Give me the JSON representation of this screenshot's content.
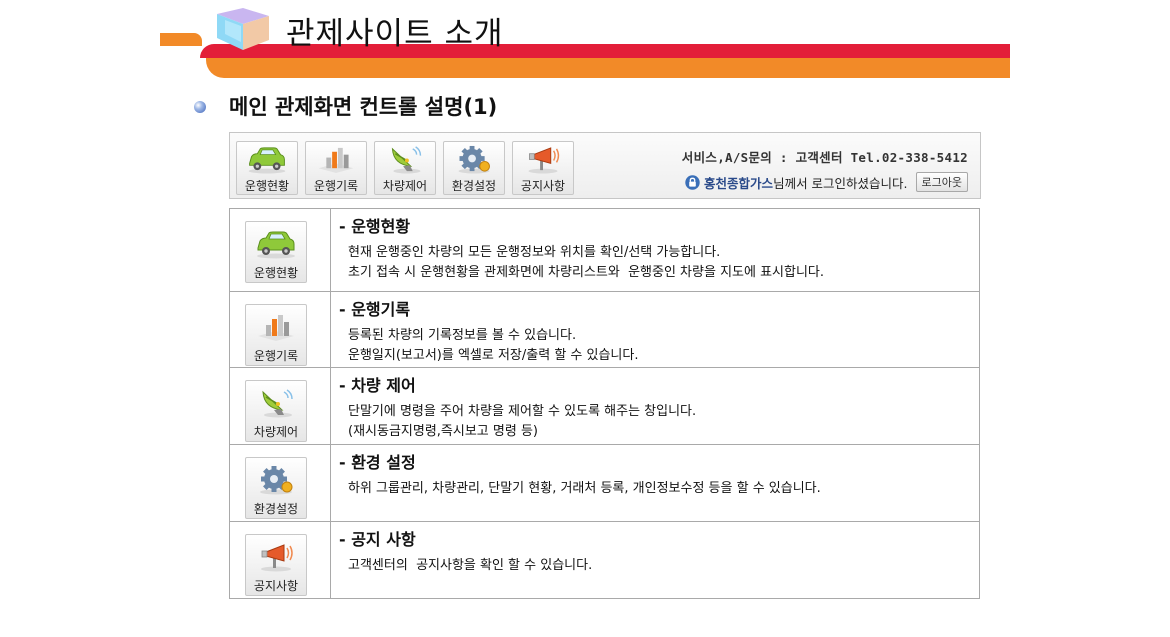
{
  "header": {
    "title": "관제사이트 소개",
    "accent_red": "#e31e39",
    "accent_orange": "#f28a28",
    "icon": "cube-icon"
  },
  "section": {
    "title": "메인 관제화면 컨트롤 설명(1)"
  },
  "toolbar": {
    "buttons": [
      {
        "label": "운행현황",
        "icon": "car-icon"
      },
      {
        "label": "운행기록",
        "icon": "bar-chart-icon"
      },
      {
        "label": "차량제어",
        "icon": "satellite-dish-icon"
      },
      {
        "label": "환경설정",
        "icon": "gear-icon"
      },
      {
        "label": "공지사항",
        "icon": "megaphone-icon"
      }
    ],
    "contact": "서비스,A/S문의 : 고객센터 Tel.02-338-5412",
    "company": "홍천종합가스",
    "login_suffix": "님께서 로그인하셨습니다.",
    "logout_label": "로그아웃"
  },
  "items": [
    {
      "title": "- 운행현황",
      "button_label": "운행현황",
      "icon": "car-icon",
      "lines": [
        "현재 운행중인 차량의 모든 운행정보와 위치를 확인/선택 가능합니다.",
        "초기 접속 시 운행현황을 관제화면에 차량리스트와  운행중인 차량을 지도에 표시합니다."
      ]
    },
    {
      "title": "- 운행기록",
      "button_label": "운행기록",
      "icon": "bar-chart-icon",
      "lines": [
        "등록된 차량의 기록정보를 볼 수 있습니다.",
        "운행일지(보고서)를 엑셀로 저장/출력 할 수 있습니다."
      ]
    },
    {
      "title": "- 차량 제어",
      "button_label": "차량제어",
      "icon": "satellite-dish-icon",
      "lines": [
        "단말기에 명령을 주어 차량을 제어할 수 있도록 해주는 창입니다.",
        "(재시동금지명령,즉시보고 명령 등)"
      ]
    },
    {
      "title": "- 환경 설정",
      "button_label": "환경설정",
      "icon": "gear-icon",
      "lines": [
        "하위 그룹관리, 차량관리, 단말기 현황, 거래처 등록, 개인정보수정 등을 할 수 있습니다."
      ]
    },
    {
      "title": "- 공지 사항",
      "button_label": "공지사항",
      "icon": "megaphone-icon",
      "lines": [
        "고객센터의  공지사항을 확인 할 수 있습니다."
      ]
    }
  ]
}
